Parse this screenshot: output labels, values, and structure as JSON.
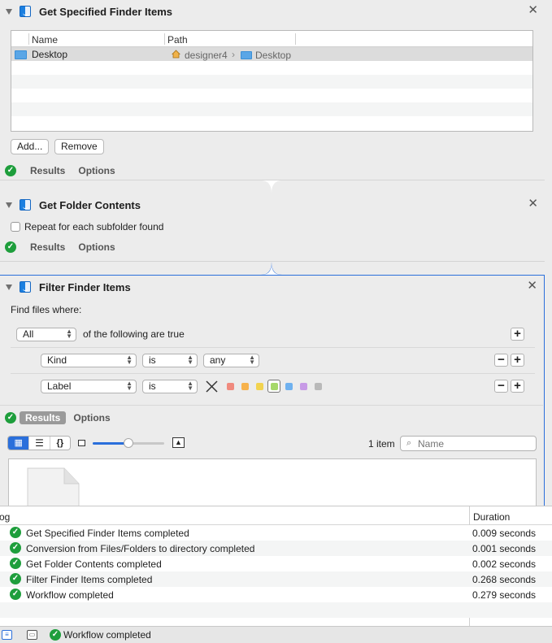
{
  "actions": [
    {
      "title": "Get Specified Finder Items",
      "table": {
        "columns": [
          "Name",
          "Path"
        ],
        "rows": [
          {
            "name": "Desktop",
            "path": [
              "designer4",
              "Desktop"
            ]
          }
        ]
      },
      "buttons": {
        "add": "Add...",
        "remove": "Remove"
      },
      "results_label": "Results",
      "options_label": "Options"
    },
    {
      "title": "Get Folder Contents",
      "checkbox_label": "Repeat for each subfolder found",
      "results_label": "Results",
      "options_label": "Options"
    },
    {
      "title": "Filter Finder Items",
      "find_label": "Find files where:",
      "quantifier": "All",
      "quantifier_suffix": "of the following are true",
      "rules": [
        {
          "field": "Kind",
          "op": "is",
          "value": "any"
        },
        {
          "field": "Label",
          "op": "is"
        }
      ],
      "label_colors": [
        "#f08a7e",
        "#f7b24c",
        "#f2d34f",
        "#a6d86a",
        "#6fb1ef",
        "#c79ae6",
        "#b9b9b9"
      ],
      "results_label": "Results",
      "options_label": "Options",
      "item_count": "1 item",
      "search_placeholder": "Name"
    }
  ],
  "log": {
    "columns": [
      "og",
      "Duration"
    ],
    "entries": [
      {
        "message": "Get Specified Finder Items completed",
        "duration": "0.009 seconds"
      },
      {
        "message": "Conversion from Files/Folders to directory completed",
        "duration": "0.001 seconds"
      },
      {
        "message": "Get Folder Contents completed",
        "duration": "0.002 seconds"
      },
      {
        "message": "Filter Finder Items completed",
        "duration": "0.268 seconds"
      },
      {
        "message": "Workflow completed",
        "duration": "0.279 seconds"
      }
    ]
  },
  "status": {
    "message": "Workflow completed"
  },
  "colors": {
    "accent": "#2a6fdb",
    "success": "#1e9e3c"
  }
}
